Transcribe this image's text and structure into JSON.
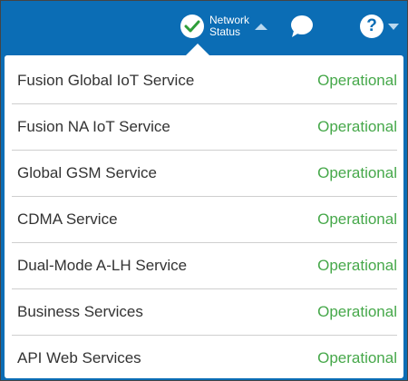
{
  "header": {
    "network_status_label_line1": "Network",
    "network_status_label_line2": "Status",
    "help_symbol": "?",
    "icons": {
      "status": "check-circle-icon",
      "expand": "caret-up-icon",
      "chat": "chat-bubble-icon",
      "help": "help-circle-icon",
      "help_menu": "caret-down-icon"
    }
  },
  "services": [
    {
      "name": "Fusion Global IoT Service",
      "status": "Operational"
    },
    {
      "name": "Fusion NA IoT Service",
      "status": "Operational"
    },
    {
      "name": "Global GSM Service",
      "status": "Operational"
    },
    {
      "name": "CDMA Service",
      "status": "Operational"
    },
    {
      "name": "Dual-Mode A-LH Service",
      "status": "Operational"
    },
    {
      "name": "Business Services",
      "status": "Operational"
    },
    {
      "name": "API Web Services",
      "status": "Operational"
    }
  ],
  "colors": {
    "header_bg": "#0b6db5",
    "status_ok": "#46a84a",
    "check": "#2e9e3a"
  }
}
